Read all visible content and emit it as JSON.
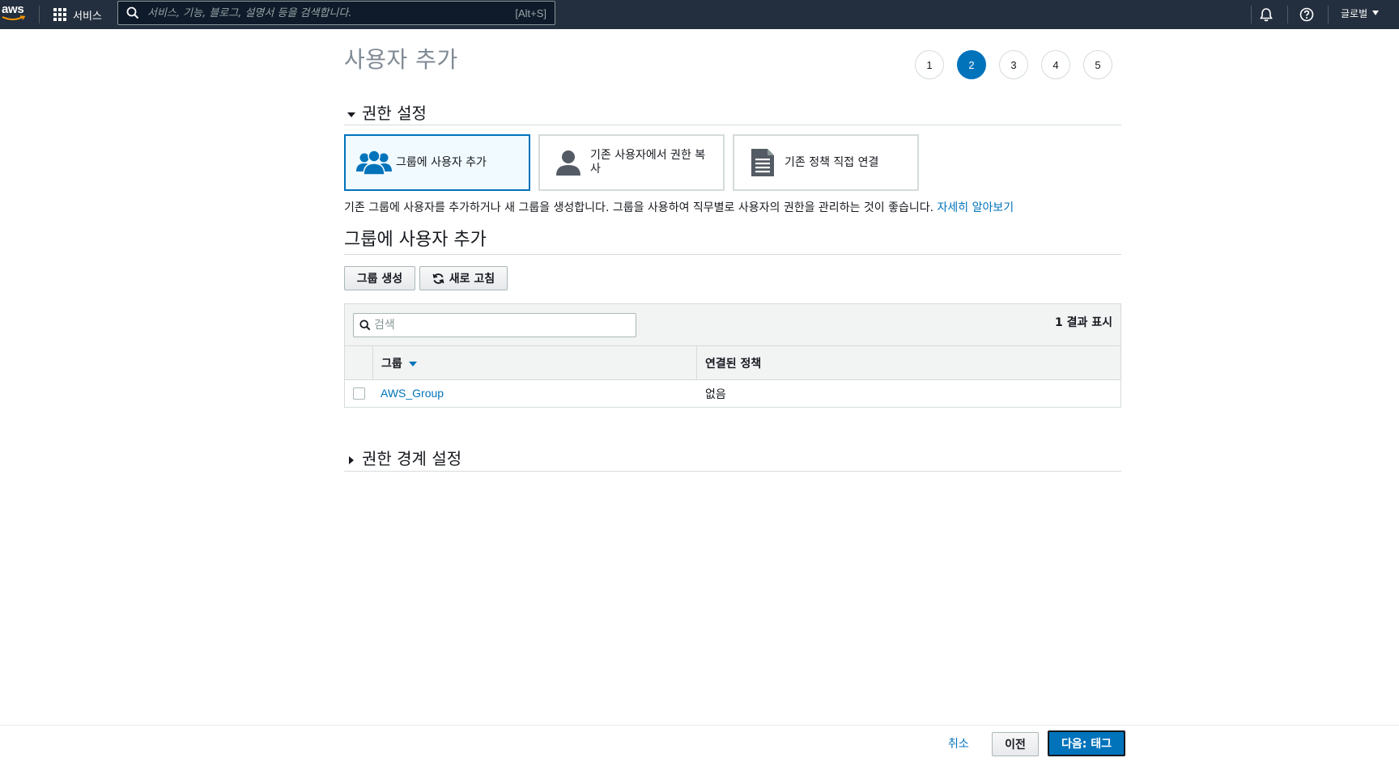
{
  "nav": {
    "logo_text": "aws",
    "services_label": "서비스",
    "search_placeholder": "서비스, 기능, 블로그, 설명서 등을 검색합니다.",
    "search_shortcut": "[Alt+S]",
    "region_label": "글로벌"
  },
  "page": {
    "title": "사용자 추가",
    "steps": [
      "1",
      "2",
      "3",
      "4",
      "5"
    ],
    "active_step": "2"
  },
  "permissions": {
    "section_title": "권한 설정",
    "options": [
      {
        "label": "그룹에 사용자 추가",
        "icon": "users-group-icon",
        "selected": true
      },
      {
        "label": "기존 사용자에서 권한 복사",
        "icon": "user-icon",
        "selected": false
      },
      {
        "label": "기존 정책 직접 연결",
        "icon": "document-icon",
        "selected": false
      }
    ],
    "description": "기존 그룹에 사용자를 추가하거나 새 그룹을 생성합니다. 그룹을 사용하여 직무별로 사용자의 권한을 관리하는 것이 좋습니다.",
    "learn_more": "자세히 알아보기"
  },
  "group_section": {
    "title": "그룹에 사용자 추가",
    "create_button": "그룹 생성",
    "refresh_button": "새로 고침",
    "search_placeholder": "검색",
    "result_count": "1 결과 표시",
    "columns": [
      "그룹",
      "연결된 정책"
    ],
    "rows": [
      {
        "group": "AWS_Group",
        "policy": "없음"
      }
    ]
  },
  "boundary": {
    "section_title": "권한 경계 설정"
  },
  "footer": {
    "cancel": "취소",
    "previous": "이전",
    "next": "다음: 태그"
  },
  "colors": {
    "nav_bg": "#232f3e",
    "accent": "#0073bb",
    "border": "#d5dbdb"
  }
}
